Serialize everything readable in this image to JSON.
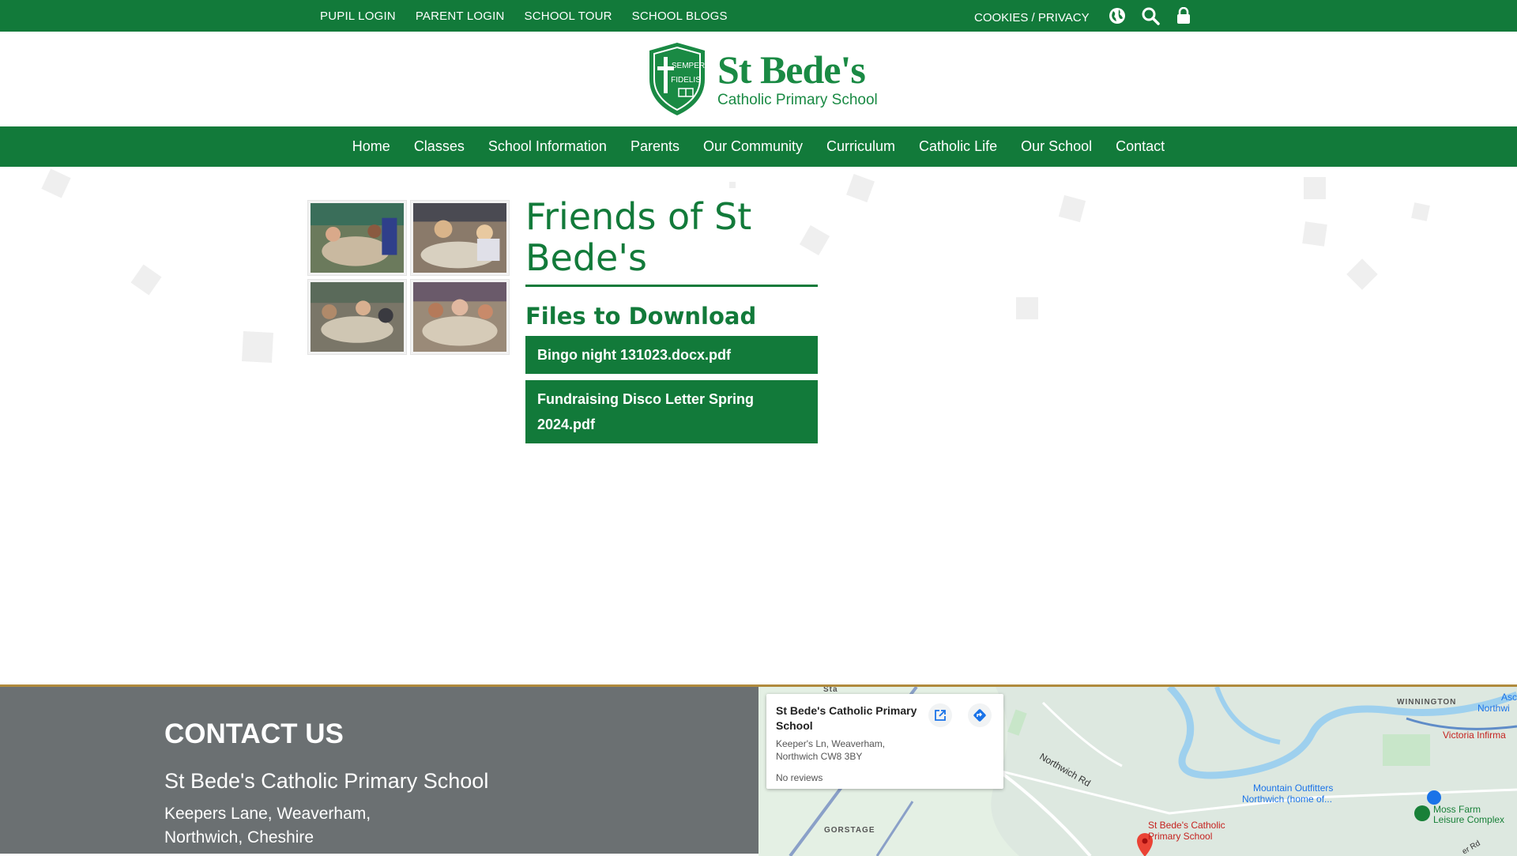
{
  "topbar": {
    "links": [
      "PUPIL LOGIN",
      "PARENT LOGIN",
      "SCHOOL TOUR",
      "SCHOOL BLOGS"
    ],
    "cookies": "COOKIES / PRIVACY",
    "icons": [
      "globe-icon",
      "search-icon",
      "lock-icon"
    ]
  },
  "logo": {
    "crest_text": [
      "SEMPER",
      "FIDELIS"
    ],
    "title": "St Bede's",
    "subtitle": "Catholic Primary School"
  },
  "nav": [
    "Home",
    "Classes",
    "School Information",
    "Parents",
    "Our Community",
    "Curriculum",
    "Catholic Life",
    "Our School",
    "Contact"
  ],
  "page": {
    "title": "Friends of St Bede's",
    "files_heading": "Files to Download",
    "files": [
      "Bingo night 131023.docx.pdf",
      "Fundraising Disco Letter Spring 2024.pdf"
    ]
  },
  "footer": {
    "contact_title": "CONTACT US",
    "school_name": "St Bede's Catholic Primary School",
    "address_line1": "Keepers Lane, Weaverham,",
    "address_line2": "Northwich, Cheshire"
  },
  "map": {
    "card_title": "St Bede's Catholic Primary School",
    "card_address": "Keeper's Ln, Weaverham, Northwich CW8 3BY",
    "card_reviews": "No reviews",
    "labels": {
      "winnington": "WINNINGTON",
      "northwich_cut": "Northwi",
      "victoria": "Victoria Infirma",
      "northwich_rd": "Northwich Rd",
      "mountain": "Mountain Outfitters",
      "mountain2": "Northwich (home of...",
      "moss_farm": "Moss Farm",
      "leisure": "Leisure Complex",
      "gorstage": "GORSTAGE",
      "pin_label1": "St Bede's Catholic",
      "pin_label2": "Primary School",
      "top_cut": "Sta",
      "asc": "Asc",
      "rd_cut": "er Rd"
    }
  },
  "colors": {
    "brand_green": "#127a3a",
    "footer_grey": "#6b7072",
    "footer_accent": "#b08a3c"
  }
}
